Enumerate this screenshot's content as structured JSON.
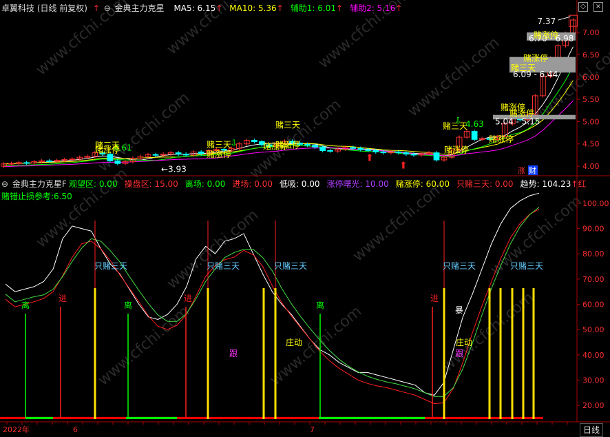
{
  "window": {
    "title": "卓翼科技 (日线 前复权)",
    "restore_glyph": "◇",
    "close_glyph": "×"
  },
  "main_panel": {
    "indicator_name": "金典主力克星",
    "legend": [
      {
        "label": "MA5: 6.15",
        "color": "#ffffff"
      },
      {
        "label": "MA10: 5.36",
        "color": "#ffff00"
      },
      {
        "label": "辅助1: 6.01",
        "color": "#00ff00"
      },
      {
        "label": "辅助2: 5.16",
        "color": "#ff00ff"
      }
    ],
    "y_ticks": [
      "7.00",
      "6.50",
      "6.00",
      "5.50",
      "5.00",
      "4.50",
      "4.00"
    ],
    "annotations": {
      "high": "7.37",
      "low": "3.93",
      "value_1": "4.61",
      "value_2": "4.63",
      "range_1": "6.70 - 6.98",
      "range_2": "6.09 - 6.44",
      "range_3": "5.04 - 5.15",
      "label_gamble_limit_up": "赌涨停",
      "label_gamble_three_days": "赌三天"
    },
    "corner_badges": [
      "涨",
      "财"
    ]
  },
  "sub_panel": {
    "indicator_name": "金典主力克星F",
    "legend": [
      {
        "label": "观望区: 0.00",
        "color": "#00ff00"
      },
      {
        "label": "操盘区: 15.00",
        "color": "#ff3030"
      },
      {
        "label": "离场: 0.00",
        "color": "#00ff00"
      },
      {
        "label": "进场: 0.00",
        "color": "#ff3030"
      },
      {
        "label": "低吸: 0.00",
        "color": "#ffffff"
      },
      {
        "label": "涨停曙光: 10.00",
        "color": "#b040ff"
      },
      {
        "label": "赌涨停: 60.00",
        "color": "#ffff00"
      },
      {
        "label": "只赌三天: 0.00",
        "color": "#ff3030"
      },
      {
        "label": "趋势: 104.23",
        "color": "#ffffff"
      }
    ],
    "trend_arrow_suffix": "红",
    "stoploss": "赌错止损参考:6.50",
    "y_ticks": [
      "100.00",
      "90.00",
      "80.00",
      "70.00",
      "60.00",
      "50.00",
      "40.00",
      "30.00",
      "20.00"
    ],
    "annotations": {
      "three_days": "只赌三天",
      "exit": "离",
      "enter": "进",
      "follow": "跟",
      "boost": "庄动",
      "storm": "暴"
    }
  },
  "bottom_axis": {
    "labels": [
      "2022年",
      "6",
      "7"
    ],
    "period_button": "日线"
  },
  "watermark": "www.cfchi.com",
  "chart_data": [
    {
      "type": "candlestick",
      "title": "卓翼科技 (日线 前复权)",
      "ylim": [
        3.8,
        7.45
      ],
      "n_bars": 76,
      "close": [
        4.05,
        4.06,
        4.08,
        4.07,
        4.1,
        4.12,
        4.11,
        4.13,
        4.15,
        4.16,
        4.2,
        4.22,
        4.3,
        4.27,
        4.12,
        4.06,
        4.1,
        4.18,
        4.22,
        4.26,
        4.25,
        4.27,
        4.3,
        4.27,
        4.25,
        4.32,
        4.28,
        4.35,
        4.38,
        4.36,
        4.4,
        4.5,
        4.58,
        4.55,
        4.48,
        4.45,
        4.5,
        4.56,
        4.52,
        4.49,
        4.47,
        4.43,
        4.35,
        4.34,
        4.38,
        4.42,
        4.4,
        4.37,
        4.35,
        4.32,
        4.3,
        4.32,
        4.3,
        4.27,
        4.25,
        4.28,
        4.3,
        4.14,
        4.2,
        4.36,
        4.65,
        4.78,
        4.6,
        4.62,
        4.6,
        4.66,
        4.95,
        5.12,
        5.04,
        5.15,
        5.58,
        6.02,
        6.43,
        6.7,
        6.98,
        7.28
      ],
      "series": [
        {
          "name": "MA5",
          "last": 6.15
        },
        {
          "name": "MA10",
          "last": 5.36
        },
        {
          "name": "辅助1",
          "last": 6.01
        },
        {
          "name": "辅助2",
          "last": 5.16
        }
      ],
      "labels": [
        "7.37",
        "3.93",
        "4.61",
        "4.63",
        "6.70 - 6.98",
        "6.09 - 6.44",
        "5.04 - 5.15"
      ]
    },
    {
      "type": "line",
      "title": "金典主力克星F",
      "ylim": [
        14,
        106
      ],
      "n_bars": 76,
      "series": [
        {
          "name": "趋势",
          "values": [
            68,
            65,
            66,
            67,
            69,
            74,
            86,
            91,
            90,
            89,
            82,
            76,
            72,
            66,
            60,
            55,
            54,
            56,
            60,
            67,
            78,
            83,
            80,
            85,
            86,
            88,
            80,
            72,
            65,
            60,
            56,
            51,
            46,
            42,
            40,
            37,
            35,
            33,
            33,
            32,
            31,
            30,
            29,
            28,
            25,
            24,
            29,
            42,
            55,
            64,
            74,
            84,
            92,
            98,
            101,
            103,
            104
          ]
        },
        {
          "name": "赌涨停",
          "values": [
            60
          ]
        }
      ],
      "legend_values": {
        "观望区": 0,
        "操盘区": 15,
        "离场": 0,
        "进场": 0,
        "低吸": 0,
        "涨停曙光": 10,
        "赌涨停": 60,
        "只赌三天": 0,
        "趋势": 104.23
      }
    }
  ]
}
